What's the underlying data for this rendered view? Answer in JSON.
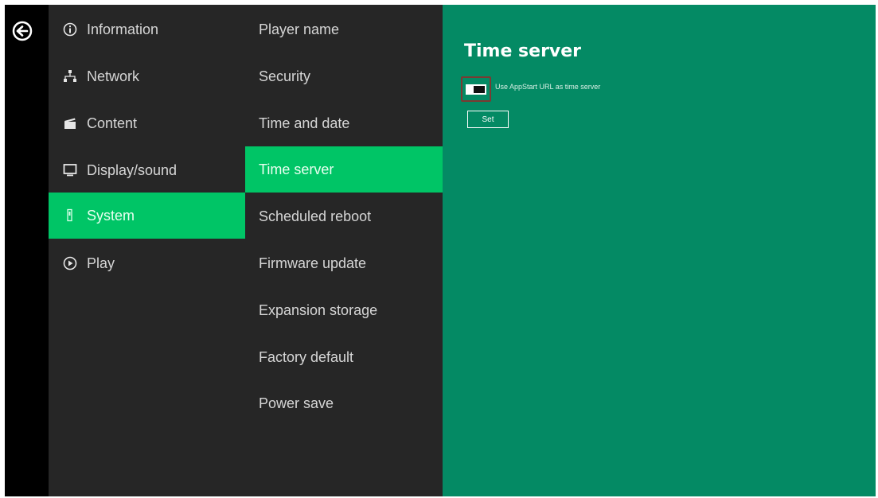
{
  "main_menu": [
    {
      "label": "Information",
      "icon": "info-icon"
    },
    {
      "label": "Network",
      "icon": "network-icon"
    },
    {
      "label": "Content",
      "icon": "clapperboard-icon"
    },
    {
      "label": "Display/sound",
      "icon": "monitor-icon"
    },
    {
      "label": "System",
      "icon": "device-icon",
      "active": true
    },
    {
      "label": "Play",
      "icon": "play-icon"
    }
  ],
  "sub_menu": [
    {
      "label": "Player name"
    },
    {
      "label": "Security"
    },
    {
      "label": "Time and date"
    },
    {
      "label": "Time server",
      "active": true
    },
    {
      "label": "Scheduled reboot"
    },
    {
      "label": "Firmware update"
    },
    {
      "label": "Expansion storage"
    },
    {
      "label": "Factory default"
    },
    {
      "label": "Power save"
    }
  ],
  "content": {
    "title": "Time server",
    "toggle_label": "Use AppStart URL as time server",
    "toggle_on": true,
    "set_label": "Set"
  },
  "colors": {
    "sidebar_bg": "#262626",
    "active_item": "#00c566",
    "content_bg": "#048a64"
  }
}
